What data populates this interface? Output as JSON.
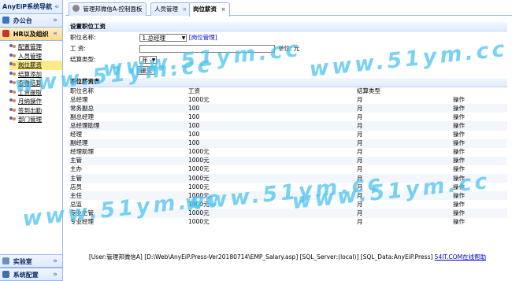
{
  "sidebar": {
    "title": "AnyEiP系统导航",
    "collapse_glyph": "«",
    "panels": {
      "office": {
        "label": "办公台",
        "chevron": "»"
      },
      "hr": {
        "label": "HR以及组织",
        "chevron": "«"
      },
      "lab": {
        "label": "实验室",
        "chevron": "»"
      },
      "sys": {
        "label": "系统配置",
        "chevron": "»"
      }
    },
    "menu": [
      {
        "label": "配置管理"
      },
      {
        "label": "人员管理"
      },
      {
        "label": "岗位薪资"
      },
      {
        "label": "结算添加"
      },
      {
        "label": "查看结算"
      },
      {
        "label": "工资提取"
      },
      {
        "label": "月纳操作"
      },
      {
        "label": "签到出勤"
      },
      {
        "label": "部门管理"
      }
    ],
    "current_index": 2
  },
  "tabs": [
    {
      "label": "管理邦微信A-控制面板",
      "closable": false,
      "active": false
    },
    {
      "label": "人员管理",
      "closable": true,
      "active": false
    },
    {
      "label": "岗位薪资",
      "closable": true,
      "active": true
    }
  ],
  "tab_close_glyph": "×",
  "form": {
    "section_title": "设置职位工资",
    "position_label": "职位名称:",
    "position_selected": "1.总经理",
    "position_view_link": "[岗位管理]",
    "salary_label": "工 资:",
    "salary_value": "",
    "unit_label": "单位: 元",
    "settle_label": "结算类型:",
    "settle_selected": "年",
    "submit_label": "提交"
  },
  "table": {
    "section_title": "职位薪资表",
    "headers": [
      "职位名称",
      "工资",
      "结算类型",
      ""
    ],
    "rows": [
      [
        "总经理",
        "1000元",
        "月",
        "操作"
      ],
      [
        "常务副总",
        "100",
        "月",
        "操作"
      ],
      [
        "副总经理",
        "100",
        "月",
        "操作"
      ],
      [
        "总经理助理",
        "100",
        "月",
        "操作"
      ],
      [
        "经理",
        "100",
        "月",
        "操作"
      ],
      [
        "副经理",
        "100",
        "月",
        "操作"
      ],
      [
        "经理助理",
        "1000元",
        "月",
        "操作"
      ],
      [
        "主管",
        "1000元",
        "月",
        "操作"
      ],
      [
        "主办",
        "1000元",
        "月",
        "操作"
      ],
      [
        "主管",
        "1000元",
        "月",
        "操作"
      ],
      [
        "店员",
        "1000元",
        "月",
        "操作"
      ],
      [
        "主任",
        "1000元",
        "月",
        "操作"
      ],
      [
        "总监",
        "1000元",
        "月",
        "操作"
      ],
      [
        "专业主管",
        "1000元",
        "月",
        "操作"
      ],
      [
        "专业经理",
        "1000元",
        "月",
        "操作"
      ]
    ]
  },
  "footer": {
    "text": "[User:管理邦微信A] [D:\\Web\\AnyEiP.Press-Ver20180714\\EMP_Salary.asp] [SQL_Server:(local)] [SQL_Data:AnyEiP.Press]",
    "link": "54IT.COM在线帮助"
  },
  "watermark": "www.51ym.cc",
  "colors": {
    "accent": "#95b8e7",
    "current_item": "#fbec88",
    "watermark": "#4ec4ee",
    "link": "#0000cc"
  }
}
